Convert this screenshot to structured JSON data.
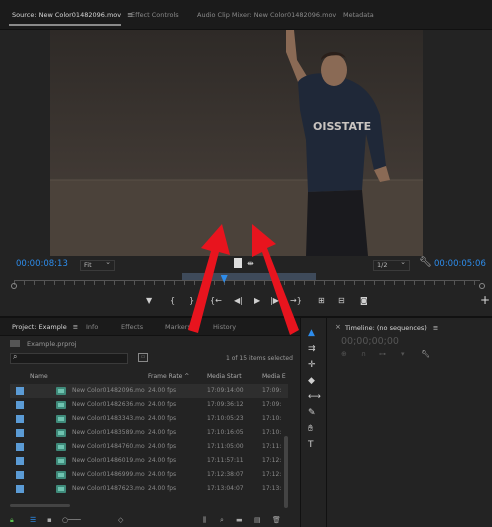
{
  "source_monitor": {
    "tabs": [
      {
        "label": "Source: New Color01482096.mov",
        "menu": "≡"
      },
      {
        "label": "Effect Controls"
      },
      {
        "label": "Audio Clip Mixer: New Color01482096.mov"
      },
      {
        "label": "Metadata"
      }
    ],
    "timecode_current": "00:00:08:13",
    "zoom_select": "Fit",
    "resolution_select": "1/2",
    "timecode_duration": "00:00:05:06",
    "playhead_fraction": 0.45
  },
  "project": {
    "tabs": [
      {
        "label": "Project: Example",
        "menu": "≡"
      },
      {
        "label": "Info"
      },
      {
        "label": "Effects"
      },
      {
        "label": "Markers"
      },
      {
        "label": "History"
      }
    ],
    "file": "Example.prproj",
    "search_placeholder": "",
    "items_info": "1 of 15 items selected",
    "columns": [
      "Name",
      "Frame Rate",
      "Media Start",
      "Media E"
    ],
    "sort_indicator": "^",
    "rows": [
      {
        "name": "New Color01482096.mo",
        "fps": "24.00 fps",
        "start": "17:09:14:00",
        "end": "17:09:",
        "selected": true
      },
      {
        "name": "New Color01482636.mo",
        "fps": "24.00 fps",
        "start": "17:09:36:12",
        "end": "17:09:",
        "selected": false
      },
      {
        "name": "New Color01483343.mo",
        "fps": "24.00 fps",
        "start": "17:10:05:23",
        "end": "17:10:",
        "selected": false
      },
      {
        "name": "New Color01483589.mo",
        "fps": "24.00 fps",
        "start": "17:10:16:05",
        "end": "17:10:",
        "selected": false
      },
      {
        "name": "New Color01484760.mo",
        "fps": "24.00 fps",
        "start": "17:11:05:00",
        "end": "17:11:",
        "selected": false
      },
      {
        "name": "New Color01486019.mo",
        "fps": "24.00 fps",
        "start": "17:11:57:11",
        "end": "17:12:",
        "selected": false
      },
      {
        "name": "New Color01486999.mo",
        "fps": "24.00 fps",
        "start": "17:12:38:07",
        "end": "17:12:",
        "selected": false
      },
      {
        "name": "New Color01487623.mo",
        "fps": "24.00 fps",
        "start": "17:13:04:07",
        "end": "17:13:",
        "selected": false
      }
    ]
  },
  "timeline": {
    "title": "Timeline: (no sequences)",
    "menu": "≡",
    "close": "×",
    "timecode": "00;00;00;00"
  },
  "icons": {
    "accent": "#2d8ceb",
    "arrow_color": "#e8141e"
  }
}
